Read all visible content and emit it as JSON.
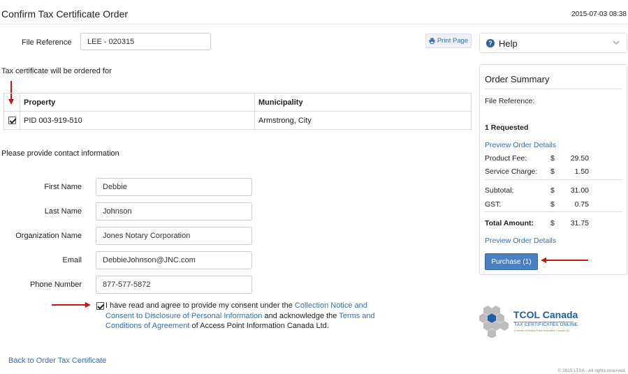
{
  "header": {
    "title": "Confirm Tax Certificate Order",
    "timestamp": "2015-07-03 08:38"
  },
  "file_reference": {
    "label": "File Reference",
    "value": "LEE - 020315"
  },
  "print_button": {
    "label": "Print Page"
  },
  "order_for_text": "Tax certificate will be ordered for",
  "property_table": {
    "headers": [
      "Property",
      "Municipality"
    ],
    "rows": [
      {
        "checked": true,
        "property": "PID 003-919-510",
        "municipality": "Armstrong, City"
      }
    ]
  },
  "contact": {
    "intro": "Please provide contact information",
    "fields": [
      {
        "label": "First Name",
        "value": "Debbie"
      },
      {
        "label": "Last Name",
        "value": "Johnson"
      },
      {
        "label": "Organization Name",
        "value": "Jones Notary Corporation"
      },
      {
        "label": "Email",
        "value": "DebbieJohnson@JNC.com"
      },
      {
        "label": "Phone Number",
        "value": "877-577-5872"
      }
    ]
  },
  "consent": {
    "checked": true,
    "text_1": "I have read and agree to provide my consent under the ",
    "link_1": "Collection Notice and Consent to Disclosure of Personal Information",
    "text_2": " and acknowledge the ",
    "link_2": "Terms and Conditions of Agreement",
    "text_3": " of Access Point Information Canada Ltd."
  },
  "back_link": "Back to Order Tax Certificate",
  "copyright": "© 2015 LTSA - All rights reserved.",
  "help_panel": {
    "title": "Help",
    "icon": "question-circle-icon"
  },
  "order_summary": {
    "title": "Order Summary",
    "file_reference_label": "File Reference:",
    "requested": "1 Requested",
    "preview_link": "Preview Order Details",
    "currency": "$",
    "product_fee_label": "Product Fee:",
    "product_fee": "29.50",
    "service_charge_label": "Service Charge:",
    "service_charge": "1.50",
    "subtotal_label": "Subtotal:",
    "subtotal": "31.00",
    "gst_label": "GST:",
    "gst": "0.75",
    "total_label": "Total Amount:",
    "total": "31.75",
    "preview_link_2": "Preview Order Details",
    "purchase_label": "Purchase (1)"
  },
  "logo": {
    "name": "TCOL Canada",
    "subtitle": "TAX CERTIFICATES ONLINE",
    "tagline": "A service of Access Point Information Canada Ltd."
  },
  "colors": {
    "link": "#3a6fb0",
    "button": "#4a7fc1",
    "annotation_arrow": "#c0171b"
  }
}
